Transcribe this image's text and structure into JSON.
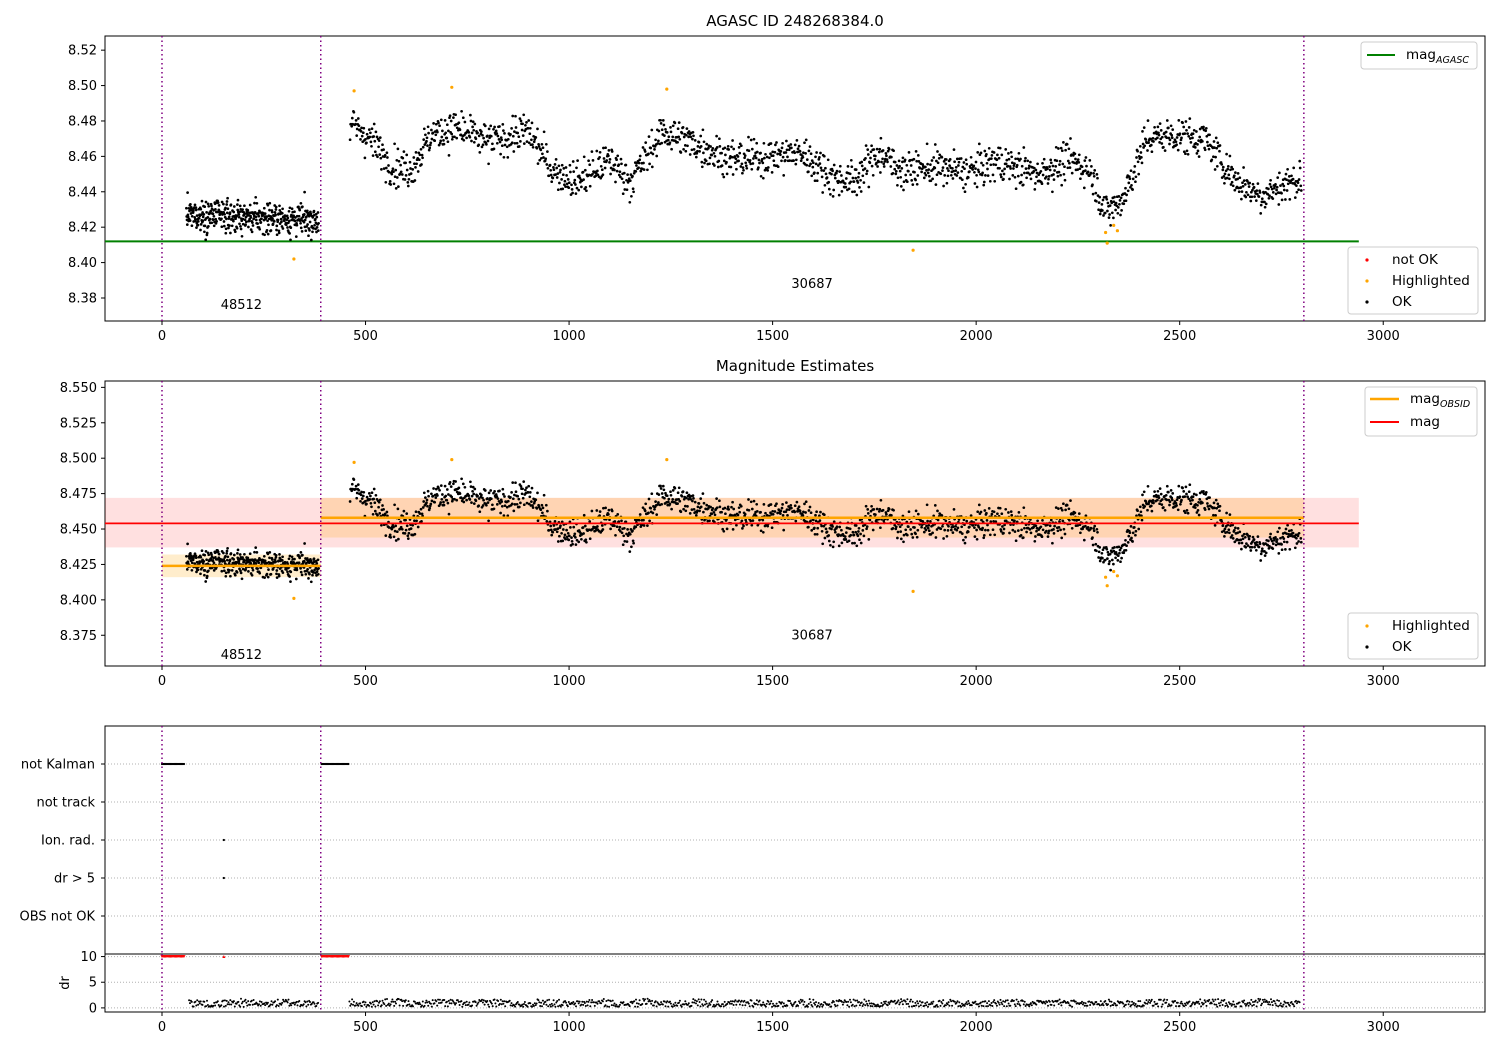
{
  "chart_data": [
    {
      "type": "scatter",
      "title": "AGASC ID 248268384.0",
      "xlim": [
        -140,
        3250
      ],
      "ylim": [
        8.367,
        8.528
      ],
      "xticks": [
        0,
        500,
        1000,
        1500,
        2000,
        2500,
        3000
      ],
      "yticks": [
        8.38,
        8.4,
        8.42,
        8.44,
        8.46,
        8.48,
        8.5,
        8.52
      ],
      "ytick_format": 2,
      "obs_boundaries": [
        0,
        390,
        2805
      ],
      "obs_labels": [
        {
          "text": "48512",
          "x": 195,
          "y": 8.376
        },
        {
          "text": "30687",
          "x": 1597,
          "y": 8.388
        }
      ],
      "mag_agasc": 8.412,
      "mag_agasc_xrange": [
        -140,
        2940
      ],
      "colors": {
        "ok": "#000000",
        "highlighted": "#ffa500",
        "not_ok": "#ff0000",
        "agasc_line": "#008000"
      },
      "highlighted_points": [
        [
          472,
          8.497
        ],
        [
          712,
          8.499
        ],
        [
          1240,
          8.498
        ],
        [
          324,
          8.402
        ],
        [
          1845,
          8.407
        ],
        [
          2318,
          8.417
        ],
        [
          2322,
          8.411
        ],
        [
          2338,
          8.421
        ],
        [
          2347,
          8.418
        ]
      ],
      "legend_upper": [
        {
          "label": "mag",
          "subscript": "AGASC",
          "color": "#008000",
          "kind": "line"
        }
      ],
      "legend_lower": [
        {
          "label": "not OK",
          "color": "#ff0000",
          "kind": "point"
        },
        {
          "label": "Highlighted",
          "color": "#ffa500",
          "kind": "point"
        },
        {
          "label": "OK",
          "color": "#000000",
          "kind": "point"
        }
      ]
    },
    {
      "type": "scatter",
      "title": "Magnitude Estimates",
      "xlim": [
        -140,
        3250
      ],
      "ylim": [
        8.3533,
        8.5545
      ],
      "xticks": [
        0,
        500,
        1000,
        1500,
        2000,
        2500,
        3000
      ],
      "yticks": [
        8.375,
        8.4,
        8.425,
        8.45,
        8.475,
        8.5,
        8.525,
        8.55
      ],
      "ytick_format": 3,
      "obs_boundaries": [
        0,
        390,
        2805
      ],
      "obs_labels": [
        {
          "text": "48512",
          "x": 195,
          "y": 8.361
        },
        {
          "text": "30687",
          "x": 1597,
          "y": 8.375
        }
      ],
      "mag": 8.454,
      "mag_band": [
        8.437,
        8.472
      ],
      "mag_xrange": [
        -140,
        2940
      ],
      "mag_obsid": [
        {
          "x0": 0,
          "x1": 390,
          "value": 8.424,
          "band": [
            8.416,
            8.432
          ]
        },
        {
          "x0": 390,
          "x1": 2805,
          "value": 8.458,
          "band": [
            8.444,
            8.472
          ]
        }
      ],
      "colors": {
        "ok": "#000000",
        "highlighted": "#ffa500",
        "mag_line": "#ff0000",
        "mag_obsid_line": "#ffa500"
      },
      "highlighted_points": [
        [
          472,
          8.497
        ],
        [
          712,
          8.499
        ],
        [
          1240,
          8.499
        ],
        [
          324,
          8.401
        ],
        [
          1845,
          8.406
        ],
        [
          2318,
          8.416
        ],
        [
          2322,
          8.41
        ],
        [
          2338,
          8.42
        ],
        [
          2347,
          8.417
        ]
      ],
      "legend_upper": [
        {
          "label": "mag",
          "subscript": "OBSID",
          "color": "#ffa500",
          "kind": "line"
        },
        {
          "label": "mag",
          "color": "#ff0000",
          "kind": "line"
        }
      ],
      "legend_lower": [
        {
          "label": "Highlighted",
          "color": "#ffa500",
          "kind": "point"
        },
        {
          "label": "OK",
          "color": "#000000",
          "kind": "point"
        }
      ]
    },
    {
      "type": "scatter",
      "xlim": [
        -140,
        3250
      ],
      "categories": [
        "not Kalman",
        "not track",
        "Ion. rad.",
        "dr > 5",
        "OBS not OK"
      ],
      "obs_boundaries": [
        0,
        390,
        2805
      ],
      "flag_segments": [
        {
          "category": "not Kalman",
          "x0": 0,
          "x1": 55
        },
        {
          "category": "not Kalman",
          "x0": 392,
          "x1": 460
        }
      ],
      "flag_points": [
        {
          "category": "Ion. rad.",
          "x": 152
        },
        {
          "category": "dr > 5",
          "x": 152
        }
      ]
    },
    {
      "type": "scatter",
      "xlim": [
        -140,
        3250
      ],
      "ylim": [
        -0.8,
        10.5
      ],
      "yticks": [
        0,
        5,
        10
      ],
      "ylabel": "dr",
      "xticks": [
        0,
        500,
        1000,
        1500,
        2000,
        2500,
        3000
      ],
      "obs_boundaries": [
        0,
        390,
        2805
      ],
      "clipped_at": 10,
      "clipped_segments": [
        {
          "x0": 0,
          "x1": 55
        },
        {
          "x0": 392,
          "x1": 460
        }
      ],
      "clipped_points": [
        152
      ],
      "dr_typical": [
        0.2,
        1.8
      ],
      "data_gaps": [
        [
          55,
          65
        ],
        [
          385,
          460
        ],
        [
          2795,
          2805
        ]
      ]
    }
  ]
}
